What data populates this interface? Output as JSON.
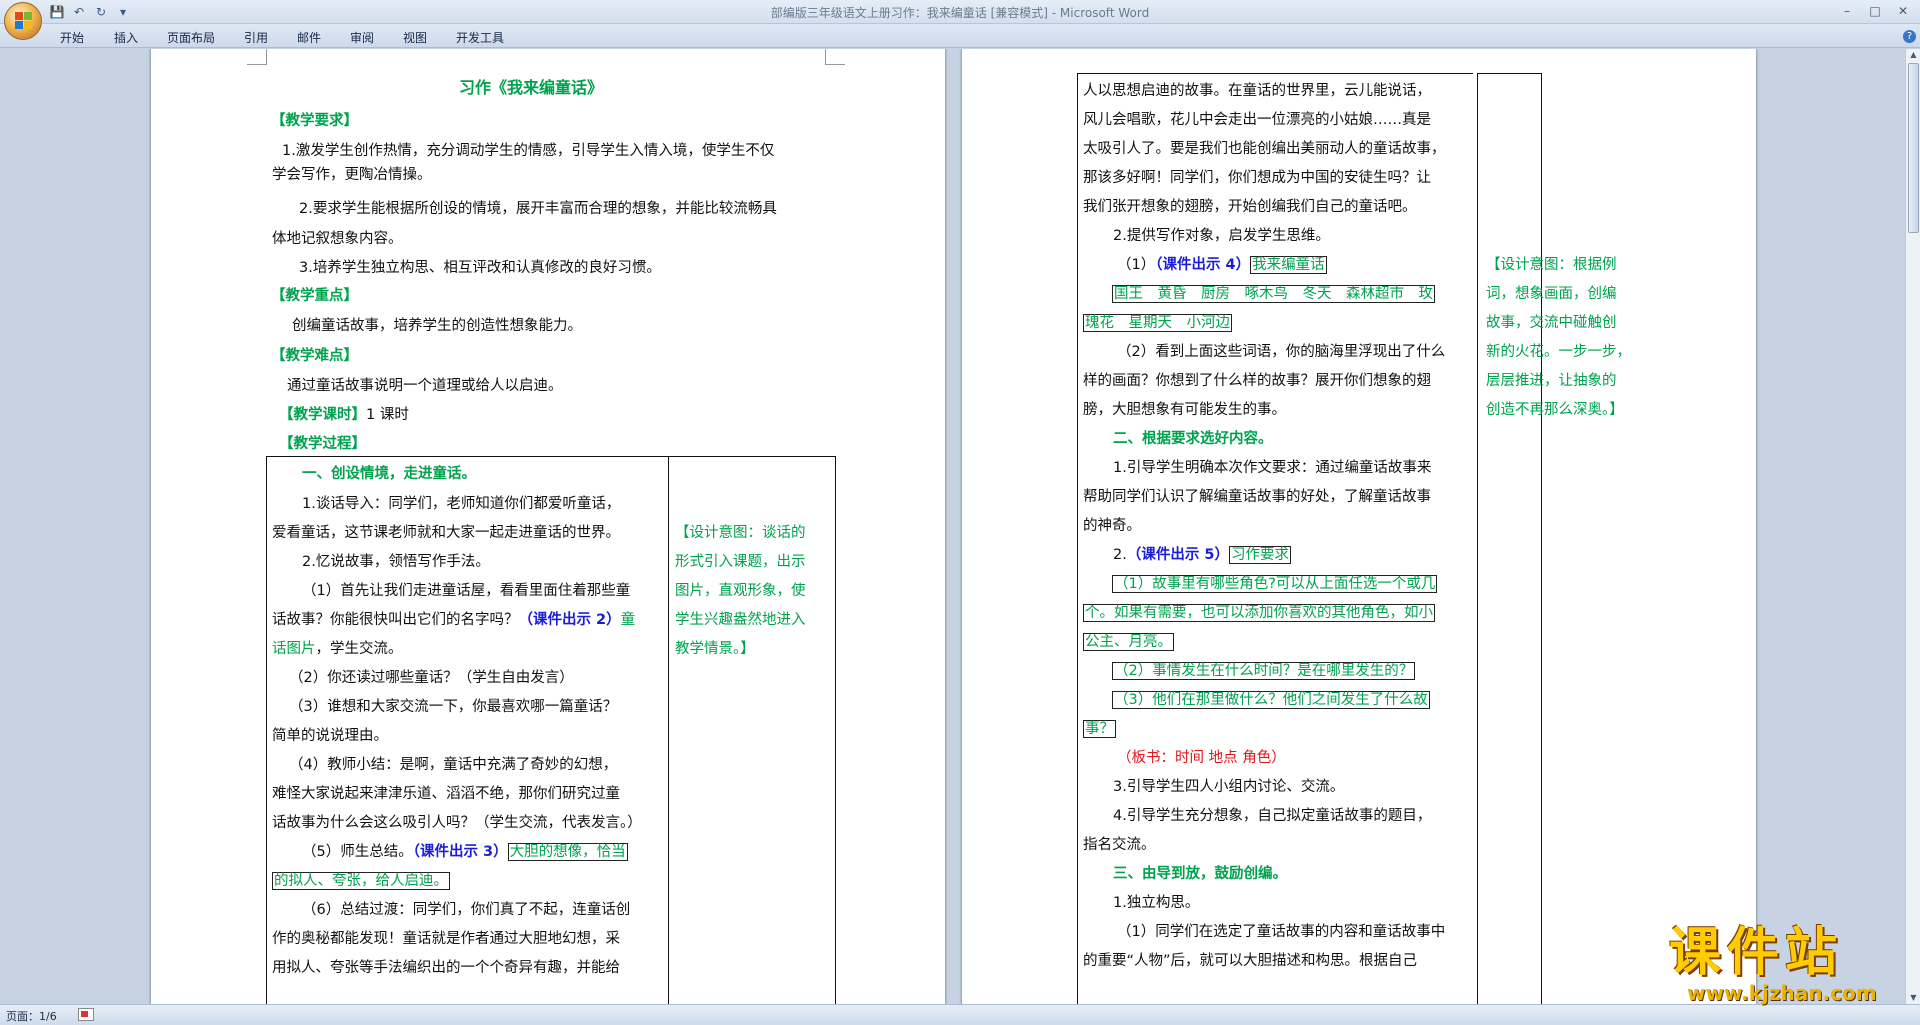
{
  "window": {
    "title": "部编版三年级语文上册习作：我来编童话 [兼容模式] - Microsoft Word",
    "controls": [
      "minimize",
      "maximize",
      "close"
    ]
  },
  "quick_access": {
    "icons": [
      "save-icon",
      "undo-icon",
      "redo-icon",
      "customize-icon"
    ]
  },
  "ribbon": {
    "tabs": [
      "开始",
      "插入",
      "页面布局",
      "引用",
      "邮件",
      "审阅",
      "视图",
      "开发工具"
    ]
  },
  "left_page": {
    "title": "习作《我来编童话》",
    "req_heading": "【教学要求】",
    "req1_a": "1.激发学生创作热情，充分调动学生的情感，引导学生入情入境，使学生不仅",
    "req1_b": "学会写作，更陶冶情操。",
    "req2_a": "2.要求学生能根据所创设的情境，展开丰富而合理的想象，并能比较流畅具",
    "req2_b": "体地记叙想象内容。",
    "req3": "3.培养学生独立构思、相互评改和认真修改的良好习惯。",
    "key_heading": "【教学重点】",
    "key_text": "创编童话故事，培养学生的创造性想象能力。",
    "diff_heading": "【教学难点】",
    "diff_text": "通过童话故事说明一个道理或给人以启迪。",
    "hours_heading": "【教学课时】",
    "hours_text": "1 课时",
    "process_heading": "【教学过程】",
    "s1_heading": "一、创设情境，走进童话。",
    "l1": "1.谈话导入：同学们，老师知道你们都爱听童话，",
    "l2": "爱看童话，这节课老师就和大家一起走进童话的世界。",
    "l3": "2.忆说故事，领悟写作手法。",
    "l4": "（1）首先让我们走进童话屋，看看里面住着那些童",
    "l5a": "话故事？你能很快叫出它们的名字吗？",
    "l5b": "（课件出示 2）",
    "l5c": "童",
    "l6a": "话图片",
    "l6b": "，学生交流。",
    "l7": "（2）你还读过哪些童话？（学生自由发言）",
    "l8": "（3）谁想和大家交流一下，你最喜欢哪一篇童话？",
    "l9": "简单的说说理由。",
    "l10": "（4）教师小结：是啊，童话中充满了奇妙的幻想，",
    "l11": "难怪大家说起来津津乐道、滔滔不绝，那你们研究过童",
    "l12": "话故事为什么会这么吸引人吗？（学生交流，代表发言。）",
    "l13a": "（5）师生总结。",
    "l13b": "（课件出示 3）",
    "l13c": "大胆的想像，恰当",
    "l14": "的拟人、夸张，给人启迪。",
    "l15": "（6）总结过渡：同学们，你们真了不起，连童话创",
    "l16": "作的奥秘都能发现！童话就是作者通过大胆地幻想，采",
    "l17": "用拟人、夸张等手法编织出的一个个奇异有趣，并能给",
    "design1": [
      "【设计意图：谈话的",
      "形式引入课题，出示",
      "图片，直观形象，使",
      "学生兴趣盎然地进入",
      "教学情景。】"
    ]
  },
  "right_page": {
    "r1": "人以思想启迪的故事。在童话的世界里，云儿能说话，",
    "r2": "风儿会唱歌，花儿中会走出一位漂亮的小姑娘……真是",
    "r3": "太吸引人了。要是我们也能创编出美丽动人的童话故事，",
    "r4": "那该多好啊！同学们，你们想成为中国的安徒生吗？让",
    "r5": "我们张开想象的翅膀，开始创编我们自己的童话吧。",
    "r6": "2.提供写作对象，启发学生思维。",
    "r7a": "（1）",
    "r7b": "（课件出示 4）",
    "r7c": "我来编童话",
    "r8": "国王　黄昏　厨房　啄木鸟　冬天　森林超市　玫",
    "r9": "瑰花　星期天　小河边",
    "r10": "（2）看到上面这些词语，你的脑海里浮现出了什么",
    "r11": "样的画面？你想到了什么样的故事？展开你们想象的翅",
    "r12": "膀，大胆想象有可能发生的事。",
    "s2_heading": "二、根据要求选好内容。",
    "r13": "1.引导学生明确本次作文要求：通过编童话故事来",
    "r14": "帮助同学们认识了解编童话故事的好处，了解童话故事",
    "r15": "的神奇。",
    "r16a": "2.",
    "r16b": "（课件出示 5）",
    "r16c": "习作要求",
    "r17": "（1）故事里有哪些角色?可以从上面任选一个或几",
    "r18": "个。如果有需要，也可以添加你喜欢的其他角色，如小",
    "r19": "公主、月亮。",
    "r20": "（2）事情发生在什么时间？是在哪里发生的？",
    "r21": "（3）他们在那里做什么？他们之间发生了什么故",
    "r22": "事？",
    "r23": "（板书：时间  地点  角色）",
    "r24": "3.引导学生四人小组内讨论、交流。",
    "r25": "4.引导学生充分想象，自己拟定童话故事的题目，",
    "r26": "指名交流。",
    "s3_heading": "三、由导到放，鼓励创编。",
    "r27": "1.独立构思。",
    "r28": "（1）同学们在选定了童话故事的内容和童话故事中",
    "r29": "的重要“人物”后，就可以大胆描述和构思。根据自己",
    "design2": [
      "【设计意图：根据例",
      "词，想象画面，创编",
      "故事，交流中碰触创",
      "新的火花。一步一步，",
      "层层推进，让抽象的",
      "创造不再那么深奥。】"
    ]
  },
  "status": {
    "page": "页面：1/6"
  },
  "watermark": {
    "text": "课件站",
    "url": "www.kjzhan.com"
  },
  "colors": {
    "green": "#00a24e",
    "blue": "#1d1dd8",
    "red": "#e0141b"
  }
}
